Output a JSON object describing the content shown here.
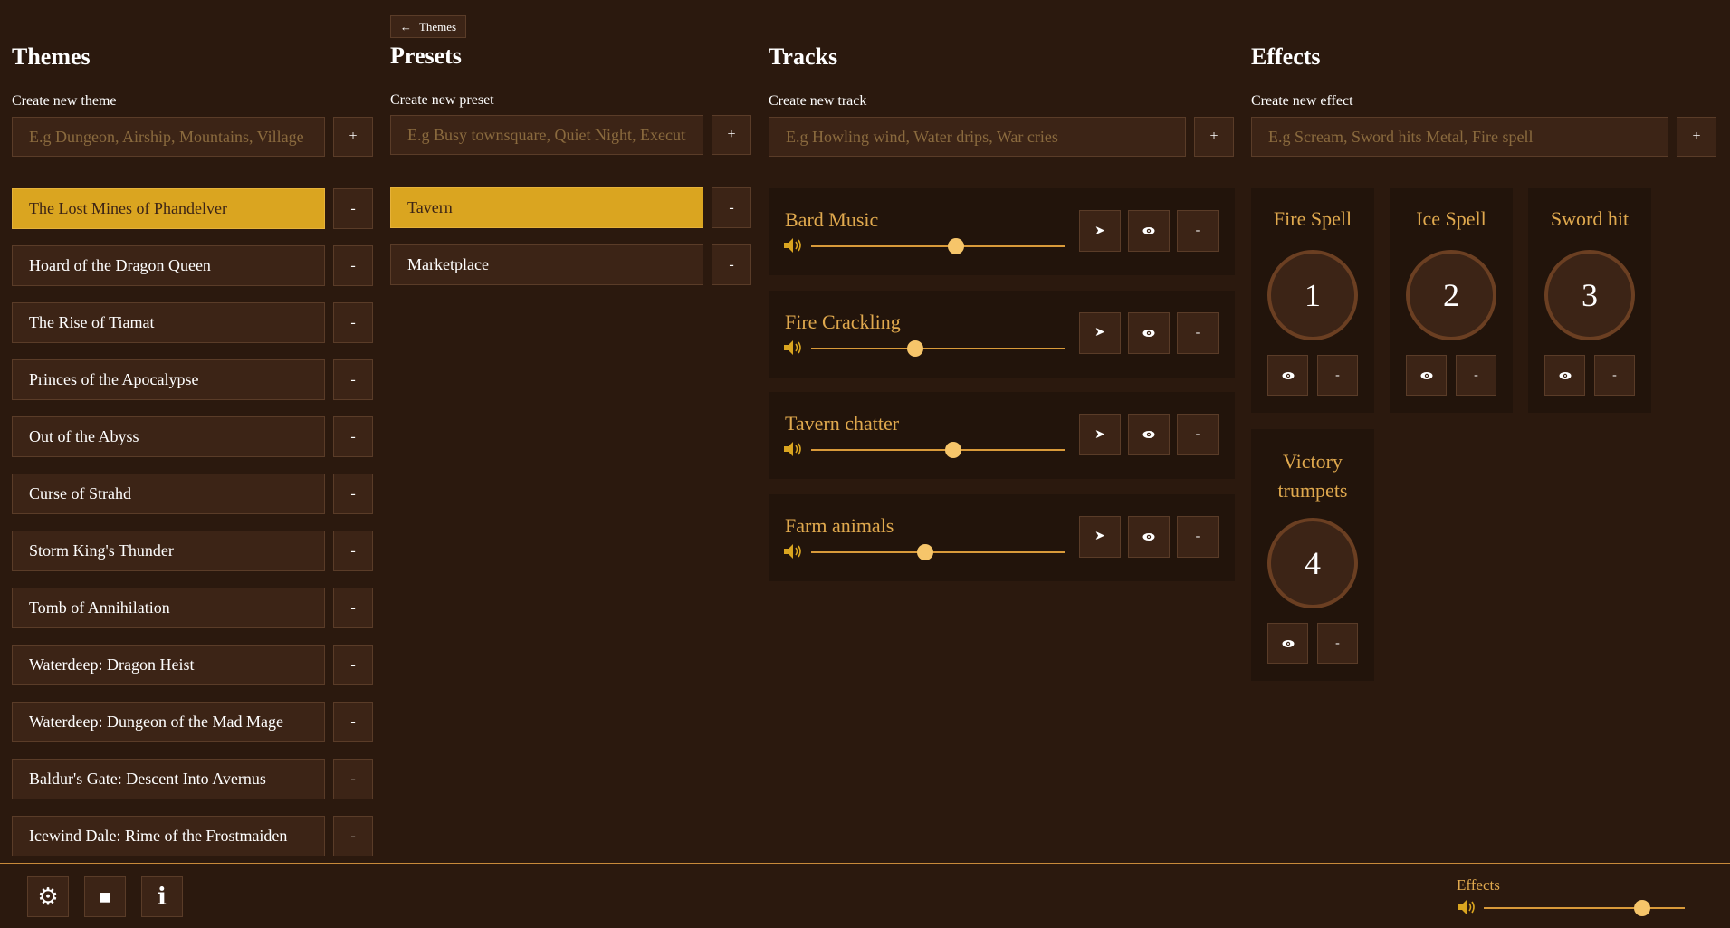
{
  "themes": {
    "title": "Themes",
    "create_label": "Create new theme",
    "placeholder": "E.g Dungeon, Airship, Mountains, Village",
    "add_label": "+",
    "remove_label": "-",
    "items": [
      {
        "label": "The Lost Mines of Phandelver",
        "active": true
      },
      {
        "label": "Hoard of the Dragon Queen"
      },
      {
        "label": "The Rise of Tiamat"
      },
      {
        "label": "Princes of the Apocalypse"
      },
      {
        "label": "Out of the Abyss"
      },
      {
        "label": "Curse of Strahd"
      },
      {
        "label": "Storm King's Thunder"
      },
      {
        "label": "Tomb of Annihilation"
      },
      {
        "label": "Waterdeep: Dragon Heist"
      },
      {
        "label": "Waterdeep: Dungeon of the Mad Mage"
      },
      {
        "label": "Baldur's Gate: Descent Into Avernus"
      },
      {
        "label": "Icewind Dale: Rime of the Frostmaiden"
      }
    ]
  },
  "presets": {
    "back_label": "Themes",
    "back_arrow": "←",
    "title": "Presets",
    "create_label": "Create new preset",
    "placeholder": "E.g Busy townsquare, Quiet Night, Execution",
    "add_label": "+",
    "remove_label": "-",
    "items": [
      {
        "label": "Tavern",
        "active": true
      },
      {
        "label": "Marketplace"
      }
    ]
  },
  "tracks": {
    "title": "Tracks",
    "create_label": "Create new track",
    "placeholder": "E.g Howling wind, Water drips, War cries",
    "add_label": "+",
    "play_glyph": "➤",
    "remove_label": "-",
    "items": [
      {
        "name": "Bard Music",
        "volume": 0.57
      },
      {
        "name": "Fire Crackling",
        "volume": 0.41
      },
      {
        "name": "Tavern chatter",
        "volume": 0.56
      },
      {
        "name": "Farm animals",
        "volume": 0.45
      }
    ]
  },
  "effects": {
    "title": "Effects",
    "create_label": "Create new effect",
    "placeholder": "E.g Scream, Sword hits Metal, Fire spell",
    "add_label": "+",
    "remove_label": "-",
    "items": [
      {
        "name": "Fire Spell",
        "key": "1"
      },
      {
        "name": "Ice Spell",
        "key": "2"
      },
      {
        "name": "Sword hit",
        "key": "3"
      },
      {
        "name": "Victory trumpets",
        "key": "4"
      }
    ]
  },
  "bottom": {
    "settings_icon": "⚙",
    "stop_icon": "■",
    "info_icon": "i",
    "effects_label": "Effects",
    "effects_volume": 0.79
  },
  "colors": {
    "background": "#2b190e",
    "accent": "#daa520",
    "track_text": "#e0a94e",
    "panel": "#3c2416"
  }
}
